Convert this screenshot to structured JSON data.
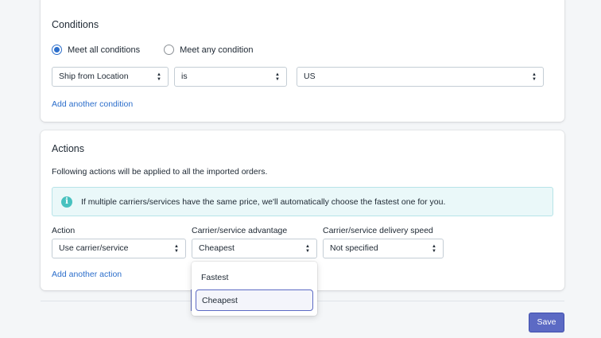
{
  "conditions": {
    "title": "Conditions",
    "match_options": [
      {
        "label": "Meet all conditions",
        "selected": true
      },
      {
        "label": "Meet any condition",
        "selected": false
      }
    ],
    "rule": {
      "field": "Ship from Location",
      "operator": "is",
      "value": "US"
    },
    "add_link": "Add another condition"
  },
  "actions": {
    "title": "Actions",
    "description": "Following actions will be applied to all the imported orders.",
    "banner_text": "If multiple carriers/services have the same price, we'll automatically choose the fastest one for you.",
    "banner_icon": "info-icon",
    "fields": {
      "action": {
        "label": "Action",
        "value": "Use carrier/service"
      },
      "advantage": {
        "label": "Carrier/service advantage",
        "value": "Cheapest"
      },
      "speed": {
        "label": "Carrier/service delivery speed",
        "value": "Not specified"
      }
    },
    "add_link": "Add another action",
    "advantage_options": [
      "Fastest",
      "Cheapest"
    ],
    "advantage_selected": "Cheapest"
  },
  "footer": {
    "save_label": "Save"
  },
  "colors": {
    "primary": "#5c6ac4",
    "link": "#2c6ecb",
    "banner_bg": "#eaf8f9",
    "info": "#47c1bf"
  }
}
